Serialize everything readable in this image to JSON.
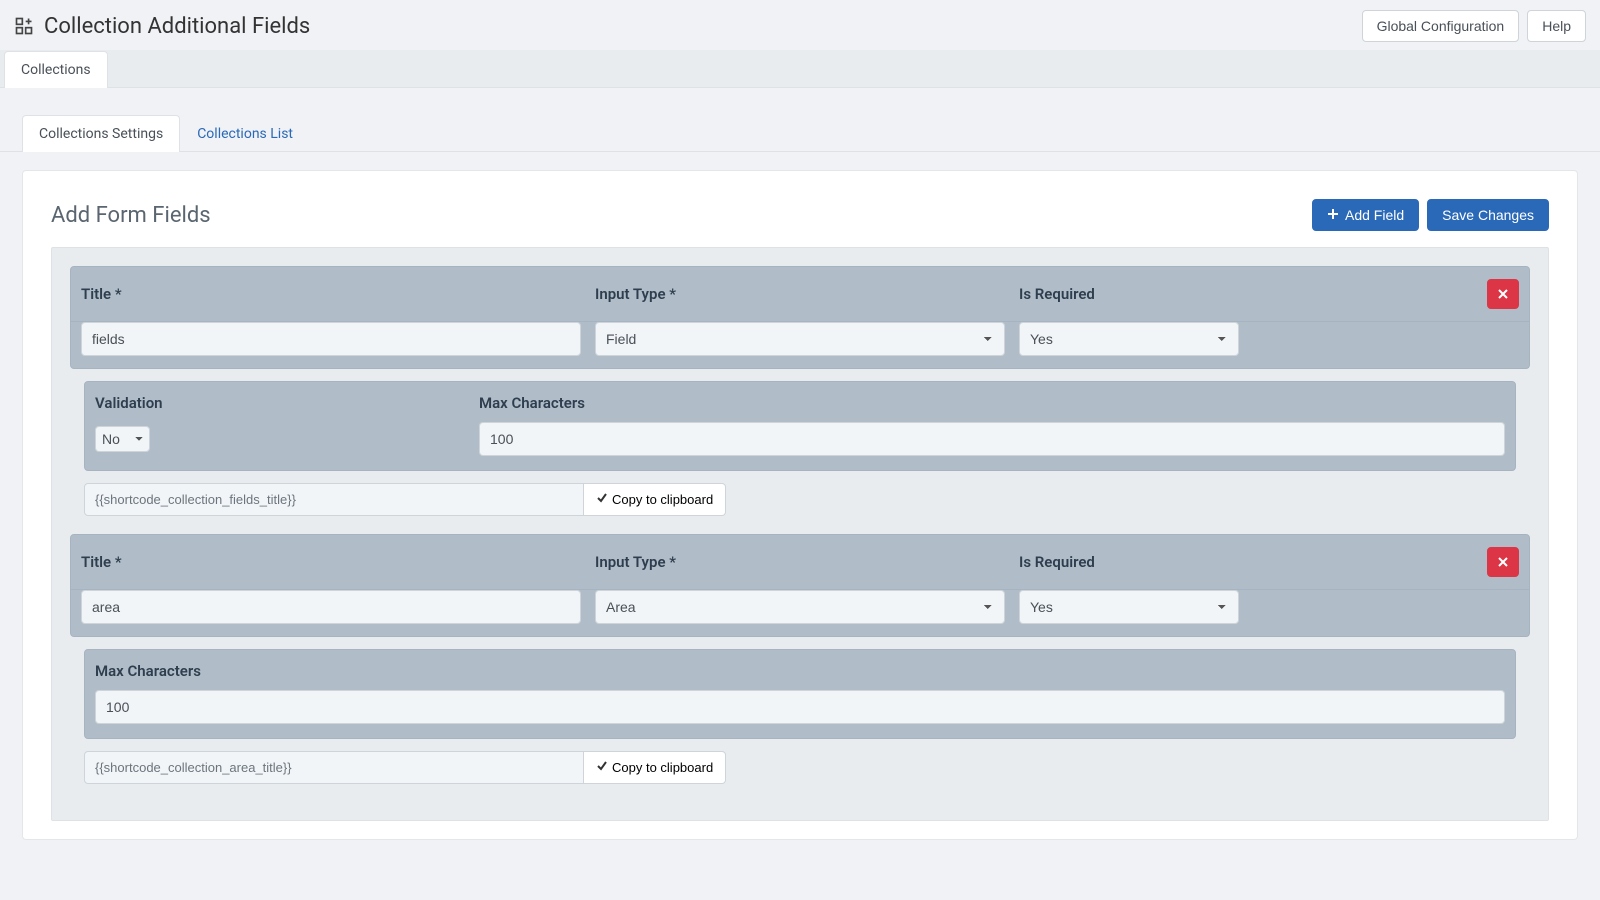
{
  "header": {
    "title": "Collection Additional Fields",
    "buttons": {
      "global_config": "Global Configuration",
      "help": "Help"
    }
  },
  "top_tabs": {
    "collections": "Collections"
  },
  "nav_tabs": {
    "settings": "Collections Settings",
    "list": "Collections List"
  },
  "card": {
    "title": "Add Form Fields",
    "add_field": "Add Field",
    "save": "Save Changes"
  },
  "labels": {
    "title": "Title *",
    "input_type": "Input Type *",
    "is_required": "Is Required",
    "validation": "Validation",
    "max_chars": "Max Characters",
    "copy": "Copy to clipboard"
  },
  "options": {
    "input_type": [
      "Field",
      "Area"
    ],
    "yes_no": [
      "Yes",
      "No"
    ]
  },
  "fields": [
    {
      "title": "fields",
      "input_type": "Field",
      "is_required": "Yes",
      "has_validation": true,
      "validation": "No",
      "max_chars": "100",
      "shortcode": "{{shortcode_collection_fields_title}}"
    },
    {
      "title": "area",
      "input_type": "Area",
      "is_required": "Yes",
      "has_validation": false,
      "max_chars": "100",
      "shortcode": "{{shortcode_collection_area_title}}"
    }
  ]
}
